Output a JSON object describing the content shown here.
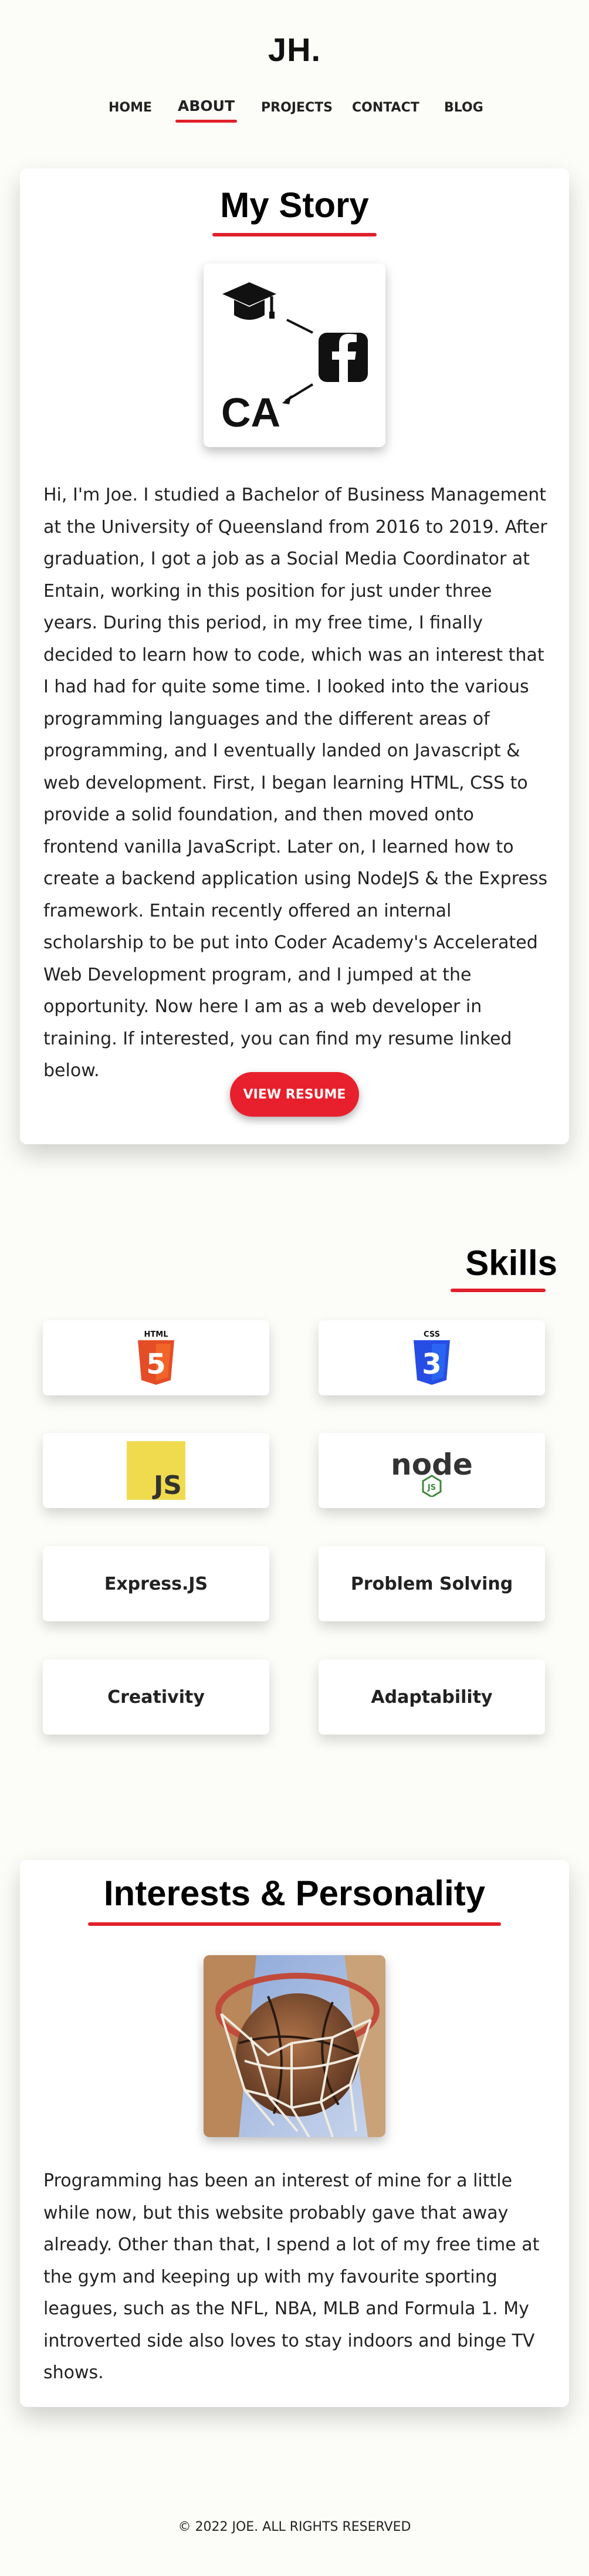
{
  "header": {
    "logo": "JH.",
    "nav": [
      {
        "label": "HOME"
      },
      {
        "label": "ABOUT",
        "active": true
      },
      {
        "label": "PROJECTS"
      },
      {
        "label": "CONTACT"
      },
      {
        "label": "BLOG"
      }
    ]
  },
  "story": {
    "title": "My Story",
    "image": {
      "icons": [
        "graduation-cap-icon",
        "facebook-icon"
      ],
      "text": "CA"
    },
    "paragraph": "Hi, I'm Joe. I studied a Bachelor of Business Management at the University of Queensland from 2016 to 2019. After graduation, I got a job as a Social Media Coordinator at Entain, working in this position for just under three years. During this period, in my free time, I finally decided to learn how to code, which was an interest that I had had for quite some time. I looked into the various programming languages and the different areas of programming, and I eventually landed on Javascript & web development. First, I began learning HTML, CSS to provide a solid foundation, and then moved onto frontend vanilla JavaScript. Later on, I learned how to create a backend application using NodeJS & the Express framework. Entain recently offered an internal scholarship to be put into Coder Academy's Accelerated Web Development program, and I jumped at the opportunity. Now here I am as a web developer in training. If interested, you can find my resume linked below.",
    "button": "VIEW RESUME"
  },
  "skills": {
    "title": "Skills",
    "items": [
      {
        "type": "logo",
        "icon": "html5-icon",
        "text": "HTML",
        "glyph": "5"
      },
      {
        "type": "logo",
        "icon": "css3-icon",
        "text": "CSS",
        "glyph": "3"
      },
      {
        "type": "logo",
        "icon": "javascript-icon",
        "text": "JS"
      },
      {
        "type": "logo",
        "icon": "nodejs-icon",
        "text": "node",
        "subtext": "JS"
      },
      {
        "type": "text",
        "label": "Express.JS"
      },
      {
        "type": "text",
        "label": "Problem Solving"
      },
      {
        "type": "text",
        "label": "Creativity"
      },
      {
        "type": "text",
        "label": "Adaptability"
      }
    ]
  },
  "interests": {
    "title": "Interests & Personality",
    "image": {
      "icon": "basketball-hoop-icon"
    },
    "paragraph": "Programming has been an interest of mine for a little while now, but this website probably gave that away already. Other than that, I spend a lot of my free time at the gym and keeping up with my favourite sporting leagues, such as the NFL, NBA, MLB and Formula 1. My introverted side also loves to stay indoors and binge TV shows."
  },
  "footer": {
    "text": "© 2022 JOE. ALL RIGHTS RESERVED"
  },
  "colors": {
    "accent": "#e0202a",
    "background": "#fcfcf8",
    "html5": "#e44d26",
    "css3": "#264de4",
    "js": "#f0db4f",
    "node": "#3c873a"
  }
}
